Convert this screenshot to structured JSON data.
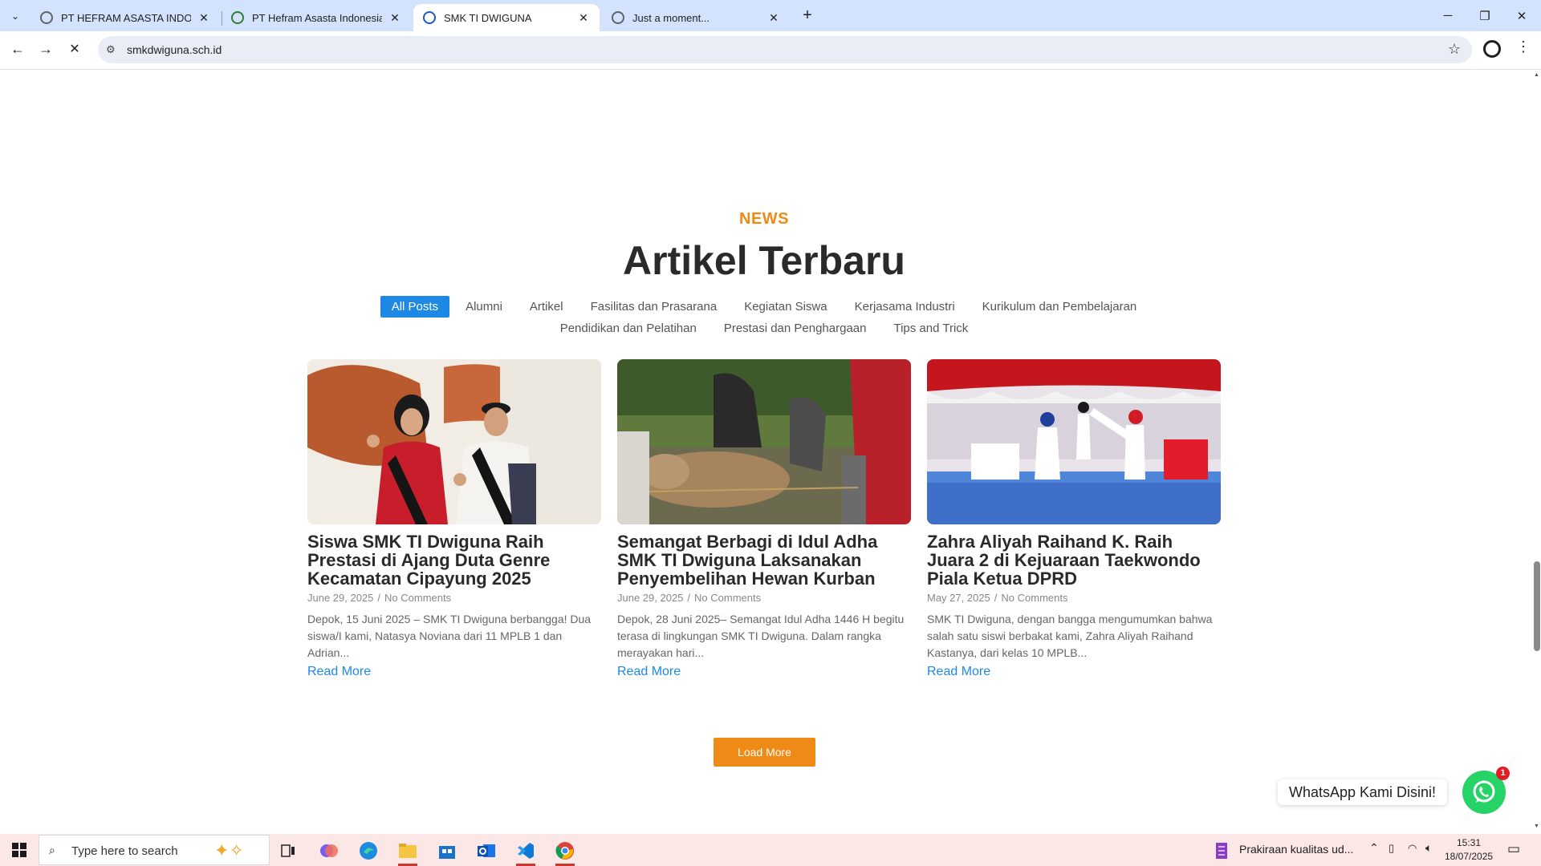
{
  "browser": {
    "tabs": [
      {
        "title": "PT HEFRAM ASASTA INDONESIA",
        "active": false
      },
      {
        "title": "PT Hefram Asasta Indonesia - P",
        "active": false
      },
      {
        "title": "SMK TI DWIGUNA",
        "active": true
      },
      {
        "title": "Just a moment...",
        "active": false
      }
    ],
    "new_tab_label": "+",
    "url": "smkdwiguna.sch.id"
  },
  "section": {
    "eyebrow": "NEWS",
    "heading": "Artikel Terbaru"
  },
  "filters": [
    {
      "label": "All Posts",
      "active": true
    },
    {
      "label": "Alumni"
    },
    {
      "label": "Artikel"
    },
    {
      "label": "Fasilitas dan Prasarana"
    },
    {
      "label": "Kegiatan Siswa"
    },
    {
      "label": "Kerjasama Industri"
    },
    {
      "label": "Kurikulum dan Pembelajaran"
    },
    {
      "label": "Pendidikan dan Pelatihan"
    },
    {
      "label": "Prestasi dan Penghargaan"
    },
    {
      "label": "Tips and Trick"
    }
  ],
  "posts": [
    {
      "title": "Siswa SMK TI Dwiguna Raih Prestasi di Ajang Duta Genre Kecamatan Cipayung 2025",
      "date": "June 29, 2025",
      "comments": "No Comments",
      "excerpt": "Depok, 15 Juni 2025 – SMK TI Dwiguna berbangga! Dua siswa/I kami, Natasya Noviana dari 11 MPLB 1 dan Adrian...",
      "read_more": "Read More"
    },
    {
      "title": "Semangat Berbagi di Idul Adha SMK TI Dwiguna Laksanakan Penyembelihan Hewan Kurban",
      "date": "June 29, 2025",
      "comments": "No Comments",
      "excerpt": "Depok, 28 Juni 2025– Semangat Idul Adha 1446 H begitu terasa di lingkungan SMK TI Dwiguna. Dalam rangka merayakan hari...",
      "read_more": "Read More"
    },
    {
      "title": "Zahra Aliyah Raihand K. Raih Juara 2 di Kejuaraan Taekwondo Piala Ketua DPRD",
      "date": "May 27, 2025",
      "comments": "No Comments",
      "excerpt": "SMK TI Dwiguna, dengan bangga mengumumkan bahwa salah satu siswi berbakat kami, Zahra Aliyah Raihand Kastanya, dari kelas 10 MPLB...",
      "read_more": "Read More"
    }
  ],
  "meta_separator": "/",
  "load_more": "Load More",
  "whatsapp": {
    "label": "WhatsApp Kami Disini!",
    "badge": "1"
  },
  "taskbar": {
    "search_placeholder": "Type here to search",
    "weather": "Prakiraan kualitas ud...",
    "time": "15:31",
    "date": "18/07/2025"
  },
  "colors": {
    "accent_orange": "#f08a16",
    "link_blue": "#1e88e5",
    "whatsapp_green": "#25d366",
    "tabbar_blue": "#d3e3fd"
  }
}
